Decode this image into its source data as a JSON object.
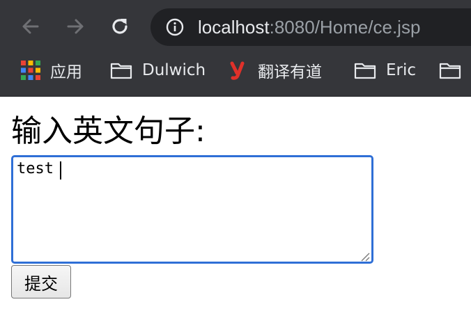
{
  "browser": {
    "url_host": "localhost",
    "url_rest": ":8080/Home/ce.jsp",
    "bookmarks": [
      {
        "label": "应用",
        "icon": "apps-grid-icon"
      },
      {
        "label": "Dulwich",
        "icon": "folder-icon"
      },
      {
        "label": "翻译有道",
        "icon": "youdao-logo-icon"
      },
      {
        "label": "Eric",
        "icon": "folder-icon"
      },
      {
        "label": "",
        "icon": "folder-icon"
      }
    ]
  },
  "form": {
    "label": "输入英文句子:",
    "input_value": "test",
    "submit_label": "提交"
  },
  "colors": {
    "toolbar_bg": "#35363a",
    "omnibox_bg": "#202124",
    "focus_ring": "#2f6fd6",
    "youdao_red": "#e0312a"
  }
}
